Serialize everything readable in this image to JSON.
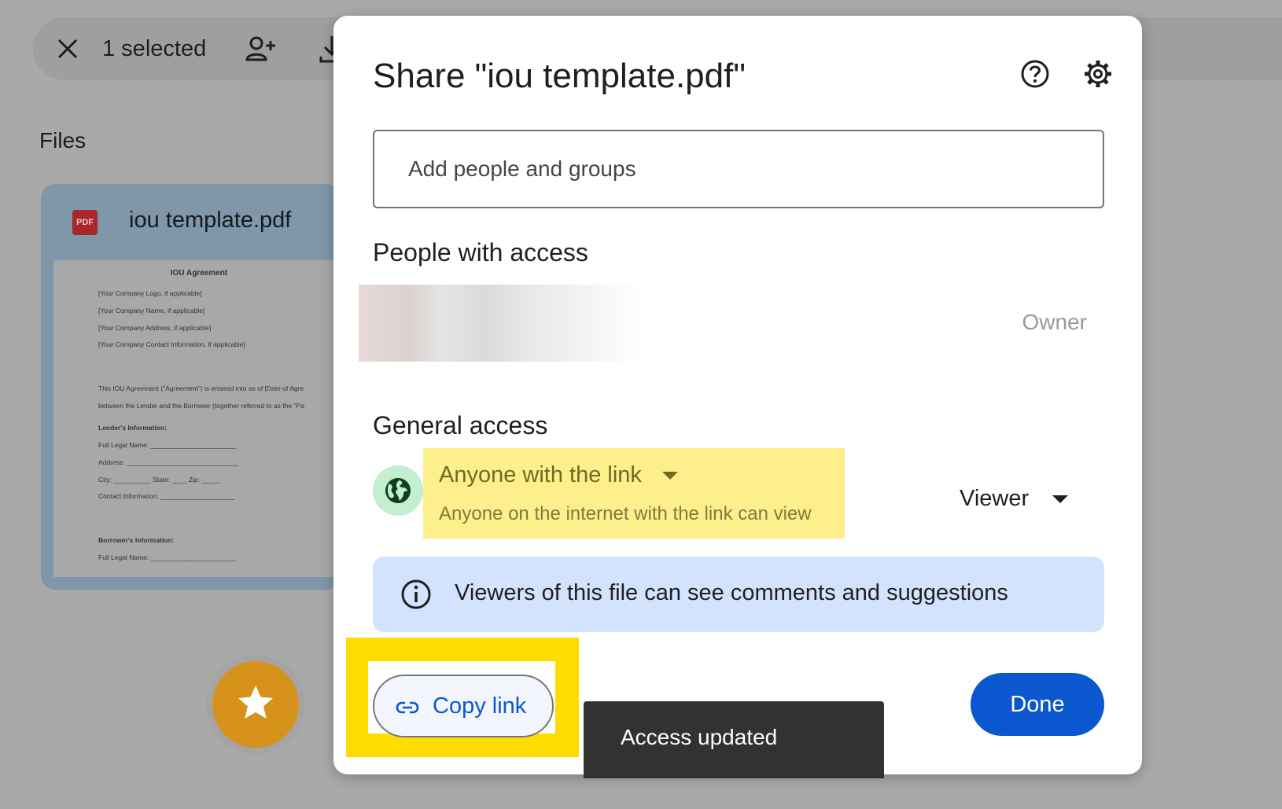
{
  "selection_bar": {
    "count_text": "1 selected",
    "close_icon": "close-icon",
    "share_icon": "person-add-icon",
    "download_icon": "download-icon"
  },
  "files": {
    "heading": "Files",
    "card": {
      "name": "iou template.pdf",
      "type_icon_text": "PDF",
      "preview": {
        "title": "IOU Agreement",
        "lines": [
          "[Your Company Logo, if applicable]",
          "[Your Company Name, if applicable]",
          "[Your Company Address, if applicable]",
          "[Your Company Contact Information, if applicable]",
          "This IOU Agreement (\"Agreement\") is entered into as of [Date of Agre",
          "between the Lender and the Borrower (together referred to as the \"Pa",
          "Lender's Information:",
          "Full Legal Name: _______________________",
          "Address: ______________________________",
          "City: __________ State: ____ Zip: _____",
          "Contact Information: ____________________",
          "Borrower's Information:",
          "Full Legal Name: _______________________"
        ]
      }
    }
  },
  "dialog": {
    "title": "Share \"iou template.pdf\"",
    "help_icon": "help-icon",
    "settings_icon": "gear-icon",
    "add_people_placeholder": "Add people and groups",
    "people_with_access_heading": "People with access",
    "owner_role": "Owner",
    "general_access_heading": "General access",
    "access_option": "Anyone with the link",
    "access_description": "Anyone on the internet with the link can view",
    "role": "Viewer",
    "info_text": "Viewers of this file can see comments and suggestions",
    "copy_link_label": "Copy link",
    "done_label": "Done"
  },
  "toast": {
    "message": "Access updated"
  },
  "colors": {
    "primary": "#0b57d0",
    "highlight_yellow": "#ffdc00",
    "info_bg": "#d3e3fd",
    "globe_bg": "#c4eed0"
  }
}
